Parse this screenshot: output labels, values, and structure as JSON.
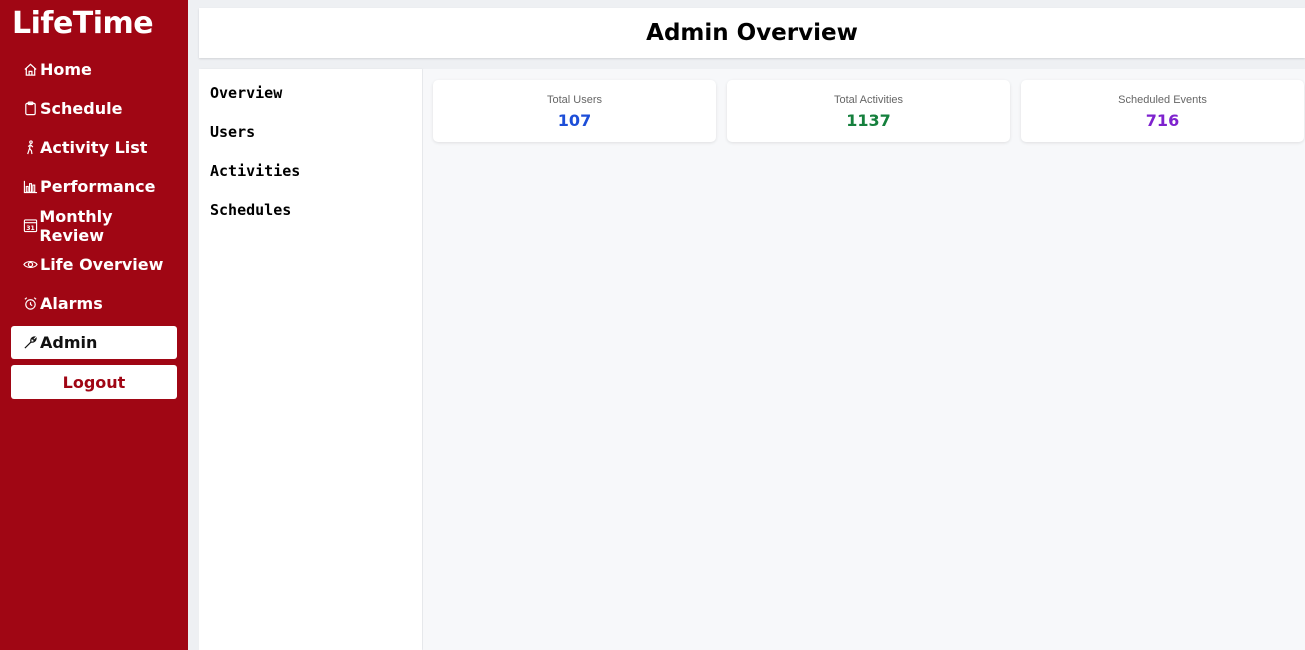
{
  "app": {
    "brand": "LifeTime"
  },
  "sidebar": {
    "items": [
      {
        "label": "Home",
        "icon": "home-icon"
      },
      {
        "label": "Schedule",
        "icon": "clipboard-icon"
      },
      {
        "label": "Activity List",
        "icon": "walking-person-icon"
      },
      {
        "label": "Performance",
        "icon": "bar-chart-icon"
      },
      {
        "label": "Monthly Review",
        "icon": "calendar-31-icon"
      },
      {
        "label": "Life Overview",
        "icon": "eye-icon"
      },
      {
        "label": "Alarms",
        "icon": "alarm-clock-icon"
      },
      {
        "label": "Admin",
        "icon": "wrench-icon",
        "active": true
      }
    ],
    "logout_label": "Logout"
  },
  "header": {
    "title": "Admin Overview"
  },
  "subnav": {
    "items": [
      {
        "label": "Overview"
      },
      {
        "label": "Users"
      },
      {
        "label": "Activities"
      },
      {
        "label": "Schedules"
      }
    ]
  },
  "stats": [
    {
      "label": "Total Users",
      "value": "107",
      "color": "#1d4ed8"
    },
    {
      "label": "Total Activities",
      "value": "1137",
      "color": "#15803d"
    },
    {
      "label": "Scheduled Events",
      "value": "716",
      "color": "#7e22ce"
    }
  ],
  "colors": {
    "sidebar_bg": "#a00614",
    "logout_text": "#a00614"
  }
}
